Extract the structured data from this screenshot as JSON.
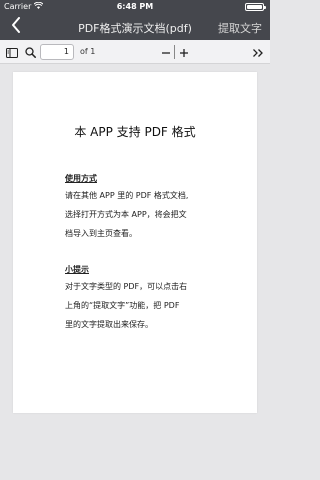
{
  "status_bar": {
    "carrier": "Carrier",
    "time": "6:48 PM"
  },
  "nav": {
    "title": "PDF格式演示文档(pdf)",
    "action": "提取文字"
  },
  "toolbar": {
    "page_value": "1",
    "page_of": "of 1"
  },
  "document": {
    "heading": "本 APP 支持 PDF 格式",
    "section1_title": "使用方式",
    "section1_lines": [
      "请在其他 APP 里的 PDF 格式文档,",
      "选择打开方式为本 APP，将会把文",
      "档导入到主页查看。"
    ],
    "section2_title": "小提示",
    "section2_lines": [
      "对于文字类型的 PDF，可以点击右",
      "上角的“提取文字”功能，把 PDF",
      "里的文字提取出来保存。"
    ]
  },
  "colors": {
    "nav_bg": "#45474d",
    "toolbar_bg": "#f2f2f4",
    "canvas_bg": "#e6e6e8"
  },
  "icons": [
    "wifi-icon",
    "battery-icon",
    "back-chevron-icon",
    "sidebar-toggle-icon",
    "search-icon",
    "zoom-out-icon",
    "zoom-in-icon",
    "more-chevrons-icon"
  ]
}
